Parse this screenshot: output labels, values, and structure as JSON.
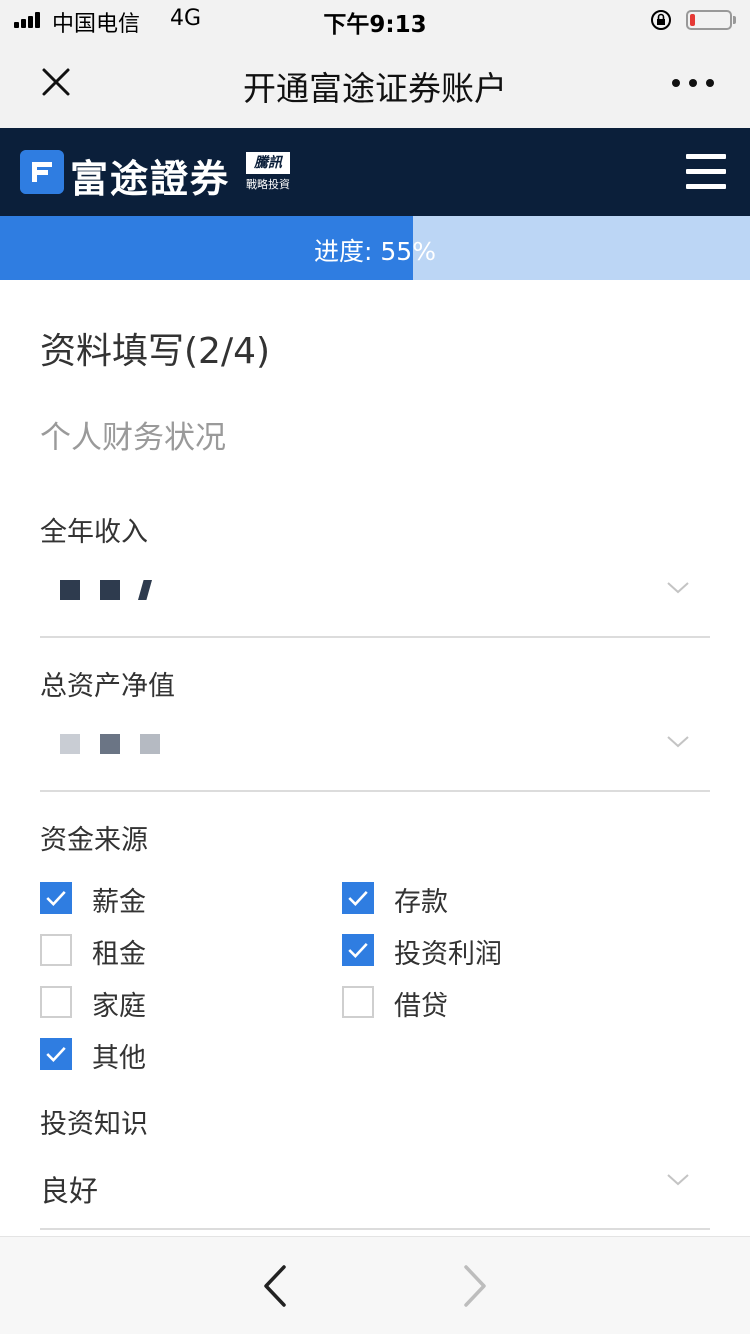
{
  "status_bar": {
    "carrier": "中国电信",
    "network": "4G",
    "time": "下午9:13",
    "signal_bars": 4,
    "battery_level": 0.12,
    "battery_color": "#e53935"
  },
  "nav": {
    "title": "开通富途证券账户",
    "close_icon": "close-icon",
    "more_icon": "more-icon"
  },
  "brand": {
    "name": "富途證券",
    "badge_top": "騰訊",
    "badge_bottom": "戰略投資"
  },
  "progress": {
    "label": "进度: 55%",
    "value": 0.55,
    "fill_color": "#2f7de1",
    "track_color": "#bcd6f5"
  },
  "form": {
    "title": "资料填写(2/4)",
    "subtitle": "个人财务状况",
    "annual_income": {
      "label": "全年收入"
    },
    "net_assets": {
      "label": "总资产净值"
    },
    "fund_source": {
      "label": "资金来源",
      "options": [
        {
          "label": "薪金",
          "checked": true
        },
        {
          "label": "存款",
          "checked": true
        },
        {
          "label": "租金",
          "checked": false
        },
        {
          "label": "投资利润",
          "checked": true
        },
        {
          "label": "家庭",
          "checked": false
        },
        {
          "label": "借贷",
          "checked": false
        },
        {
          "label": "其他",
          "checked": true
        }
      ]
    },
    "investment_knowledge": {
      "label": "投资知识",
      "value": "良好"
    }
  },
  "toolbar": {
    "back_icon": "back-arrow-icon",
    "forward_icon": "forward-arrow-icon"
  },
  "colors": {
    "brand_dark": "#0b1f3a",
    "accent": "#2f7de1"
  }
}
